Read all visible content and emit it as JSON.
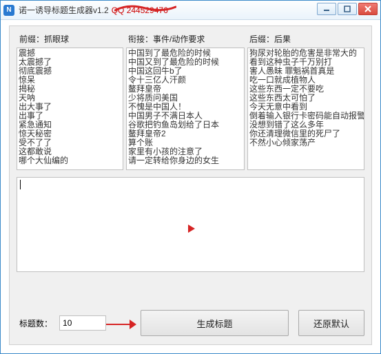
{
  "window": {
    "title": "诺一诱导标题生成器v1.2",
    "qq_text": "QQ 244529476"
  },
  "labels": {
    "prefix": "前缀：抓眼球",
    "bridge": "衔接：事件/动作要求",
    "suffix": "后缀：后果"
  },
  "lists": {
    "prefix": [
      "震撼",
      "太震撼了",
      "彻底震撼",
      "惊呆",
      "揭秘",
      "天呐",
      "出大事了",
      "出事了",
      "紧急通知",
      "惊天秘密",
      "受不了了",
      "这都敢说",
      "哪个大仙编的"
    ],
    "bridge": [
      "中国到了最危险的时候",
      "中国又到了最危险的时候",
      "中国这回牛b了",
      "令十三亿人汗颜",
      "鳌拜皇帝",
      "少将质问美国",
      "不愧是中国人！",
      "中国男子不满日本人",
      "谷歌把钓鱼岛划给了日本",
      "鳌拜皇帝2",
      "算个账",
      "家里有小孩的注意了",
      "请一定转给你身边的女生"
    ],
    "suffix": [
      "狗尿对轮胎的危害是非常大的",
      "看到这种虫子千万别打",
      "害人愚昧 罪魁祸首真是",
      "吃一口就成植物人",
      "这些东西一定不要吃",
      "这些东西太可怕了",
      "今天无意中看到",
      "倒着输入银行卡密码能自动报警",
      "没想到错了这么多年",
      "你还清理微信里的死尸了",
      "不然小心倾家荡产"
    ]
  },
  "bottom": {
    "count_label": "标题数：",
    "count_value": "10",
    "generate_label": "生成标题",
    "reset_label": "还原默认"
  }
}
